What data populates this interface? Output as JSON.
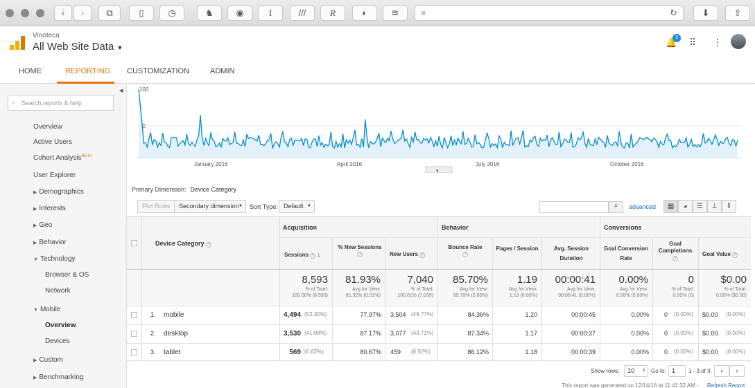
{
  "browser": {
    "traffic_lights": [
      "close",
      "minimize",
      "zoom"
    ],
    "reload_icon": "reload-icon"
  },
  "header": {
    "account": "Vinoteca",
    "property": "All Web Site Data",
    "notification_count": "3"
  },
  "nav": {
    "tabs": [
      "HOME",
      "REPORTING",
      "CUSTOMIZATION",
      "ADMIN"
    ],
    "active": "REPORTING"
  },
  "sidebar": {
    "search_placeholder": "Search reports & help",
    "items": [
      "Overview",
      "Active Users",
      "Cohort Analysis",
      "User Explorer",
      "Demographics",
      "Interests",
      "Geo",
      "Behavior",
      "Technology",
      "Browser & OS",
      "Network",
      "Mobile",
      "Overview",
      "Devices",
      "Custom",
      "Benchmarking"
    ],
    "beta": "BETA"
  },
  "chart_data": {
    "type": "line",
    "yticks": [
      "100",
      "50"
    ],
    "xticks": [
      "January 2016",
      "April 2016",
      "July 2016",
      "October 2016"
    ],
    "ylim": [
      0,
      100
    ],
    "color": "#058dc7"
  },
  "controls": {
    "primary_dimension_label": "Primary Dimension:",
    "primary_dimension_value": "Device Category",
    "plot_rows": "Plot Rows",
    "secondary_dimension": "Secondary dimension",
    "sort_type_label": "Sort Type:",
    "sort_type_value": "Default",
    "advanced": "advanced"
  },
  "table": {
    "dimension_header": "Device Category",
    "groups": [
      "Acquisition",
      "Behavior",
      "Conversions"
    ],
    "columns": [
      "Sessions",
      "% New Sessions",
      "New Users",
      "Bounce Rate",
      "Pages / Session",
      "Avg. Session Duration",
      "Goal Conversion Rate",
      "Goal Completions",
      "Goal Value"
    ],
    "totals": {
      "values": [
        "8,593",
        "81.93%",
        "7,040",
        "85.70%",
        "1.19",
        "00:00:41",
        "0.00%",
        "0",
        "$0.00"
      ],
      "sub1": [
        "% of Total:",
        "Avg for View:",
        "% of Total:",
        "Avg for View:",
        "Avg for View:",
        "Avg for View:",
        "Avg for View:",
        "% of Total:",
        "% of Total:"
      ],
      "sub2": [
        "100.00% (8,593)",
        "81.92% (0.01%)",
        "100.01% (7,039)",
        "85.70% (0.00%)",
        "1.19 (0.00%)",
        "00:00:41 (0.00%)",
        "0.00% (0.00%)",
        "0.00% (0)",
        "0.00% ($0.00)"
      ]
    },
    "rows": [
      {
        "index": "1.",
        "name": "mobile",
        "sessions": "4,494",
        "sessions_pct": "(52.30%)",
        "new_sessions": "77.97%",
        "new_users": "3,504",
        "new_users_pct": "(49.77%)",
        "bounce": "84.36%",
        "pages": "1.20",
        "duration": "00:00:45",
        "conv": "0.00%",
        "goal": "0",
        "goal_pct": "(0.00%)",
        "value": "$0.00",
        "value_pct": "(0.00%)"
      },
      {
        "index": "2.",
        "name": "desktop",
        "sessions": "3,530",
        "sessions_pct": "(41.08%)",
        "new_sessions": "87.17%",
        "new_users": "3,077",
        "new_users_pct": "(43.71%)",
        "bounce": "87.34%",
        "pages": "1.17",
        "duration": "00:00:37",
        "conv": "0.00%",
        "goal": "0",
        "goal_pct": "(0.00%)",
        "value": "$0.00",
        "value_pct": "(0.00%)"
      },
      {
        "index": "3.",
        "name": "tablet",
        "sessions": "569",
        "sessions_pct": "(6.62%)",
        "new_sessions": "80.67%",
        "new_users": "459",
        "new_users_pct": "(6.52%)",
        "bounce": "86.12%",
        "pages": "1.18",
        "duration": "00:00:39",
        "conv": "0.00%",
        "goal": "0",
        "goal_pct": "(0.00%)",
        "value": "$0.00",
        "value_pct": "(0.00%)"
      }
    ]
  },
  "footer": {
    "show_rows_label": "Show rows:",
    "show_rows_value": "10",
    "goto_label": "Go to:",
    "goto_value": "1",
    "range": "1 - 3 of 3",
    "generated": "This report was generated on 12/14/16 at 11:41:32 AM -",
    "refresh": "Refresh Report"
  }
}
